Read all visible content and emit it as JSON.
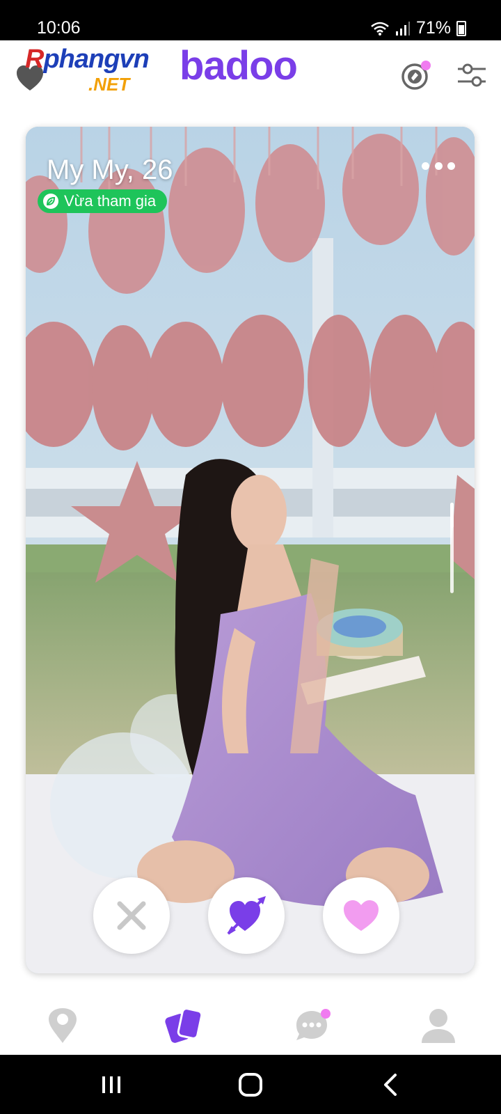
{
  "status_bar": {
    "time": "10:06",
    "battery_percent": "71%",
    "icons": [
      "wifi-icon",
      "signal-icon",
      "battery-icon"
    ]
  },
  "header": {
    "watermark_text_part1": "R",
    "watermark_text_part2": "phangvn",
    "watermark_text_part3": ".NET",
    "logo": "badoo",
    "colors": {
      "brand": "#7a3ee8",
      "notification_dot": "#f07bf0"
    },
    "icons": [
      "brand-heart-icon",
      "boost-icon",
      "filter-sliders-icon"
    ]
  },
  "profile": {
    "name_age": "My My, 26",
    "badge_label": "Vừa tham gia",
    "badge_color": "#1ec45a",
    "photo_description_icon": "profile-photo"
  },
  "actions": {
    "icons": [
      "close-x-icon",
      "crush-heart-arrow-icon",
      "like-heart-icon"
    ],
    "colors": {
      "dislike": "#c8c8c8",
      "crush": "#7a3ee8",
      "like": "#f29cf0"
    }
  },
  "bottom_nav": {
    "items": [
      "location-pin-icon",
      "encounters-cards-icon",
      "chat-bubble-icon",
      "profile-person-icon"
    ],
    "active_index": 1,
    "colors": {
      "active": "#7a3ee8",
      "inactive": "#cfcfcf"
    }
  },
  "system_nav": {
    "icons": [
      "recent-apps-icon",
      "home-icon",
      "back-icon"
    ]
  }
}
